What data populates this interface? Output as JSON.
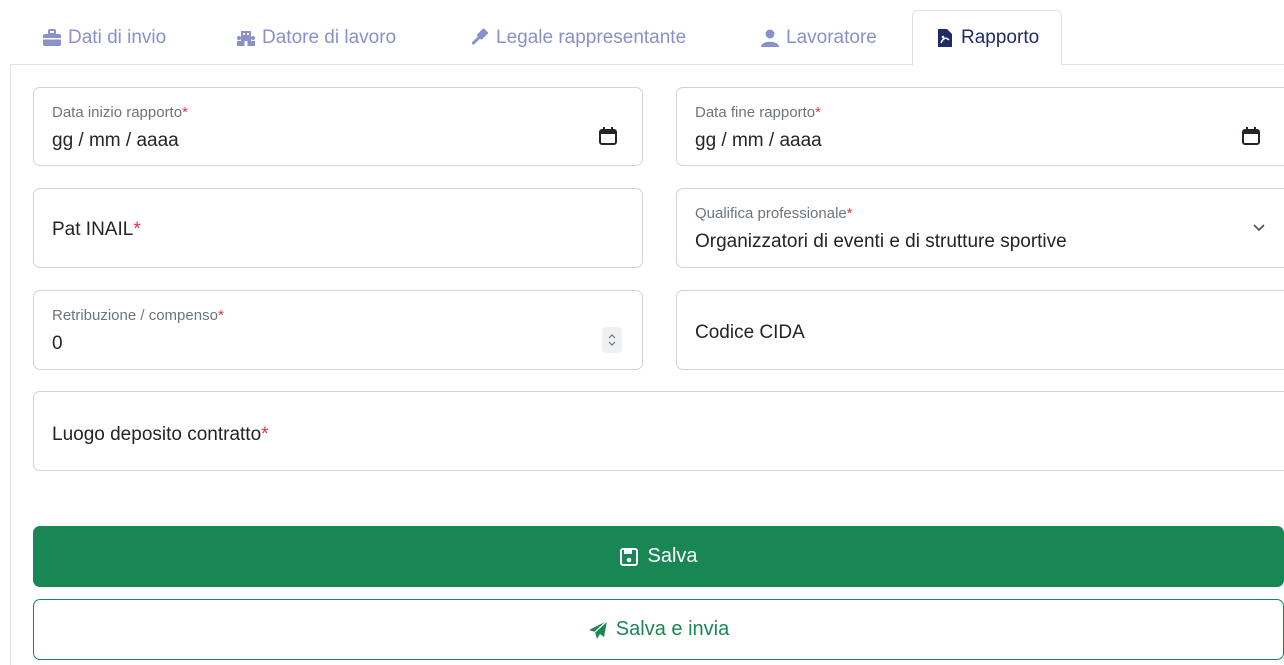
{
  "tabs": [
    {
      "label": "Dati di invio",
      "icon": "briefcase-icon"
    },
    {
      "label": "Datore di lavoro",
      "icon": "building-people-icon"
    },
    {
      "label": "Legale rappresentante",
      "icon": "gavel-icon"
    },
    {
      "label": "Lavoratore",
      "icon": "user-icon"
    },
    {
      "label": "Rapporto",
      "icon": "pdf-file-icon"
    }
  ],
  "active_tab": "Rapporto",
  "form": {
    "data_inizio": {
      "label": "Data inizio rapporto",
      "required_mark": "*",
      "value": "gg / mm / aaaa"
    },
    "data_fine": {
      "label": "Data fine rapporto",
      "required_mark": "*",
      "value": "gg / mm / aaaa"
    },
    "pat_inail": {
      "placeholder": "Pat INAIL",
      "required_mark": "*"
    },
    "qualifica": {
      "label": "Qualifica professionale",
      "required_mark": "*",
      "value": "Organizzatori di eventi e di strutture sportive"
    },
    "retribuzione": {
      "label": "Retribuzione / compenso",
      "required_mark": "*",
      "value": "0"
    },
    "codice_cida": {
      "placeholder": "Codice CIDA"
    },
    "luogo_deposito": {
      "placeholder": "Luogo deposito contratto",
      "required_mark": "*"
    }
  },
  "buttons": {
    "save_label": "Salva",
    "save_send_label": "Salva e invia"
  },
  "colors": {
    "success": "#198754",
    "required": "#dc3545",
    "tab_inactive": "#8891c9",
    "tab_active": "#1f2a6b"
  }
}
